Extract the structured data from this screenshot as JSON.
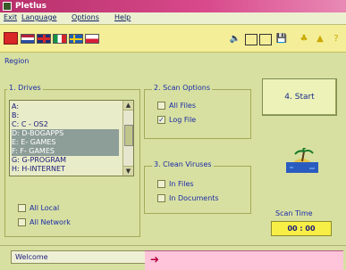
{
  "window": {
    "title": "Pletlus"
  },
  "menu": [
    "Exit",
    "Language",
    "Options",
    "Help"
  ],
  "toolbar": {
    "flags": [
      "flag-netherlands",
      "flag-uk",
      "flag-italy",
      "flag-sweden",
      "flag-poland"
    ],
    "tools": [
      "speaker",
      "window",
      "document",
      "save",
      "tree",
      "shape",
      "help"
    ]
  },
  "section": {
    "label": "Region"
  },
  "drives": {
    "title": "1. Drives",
    "rows": [
      {
        "text": "A:",
        "selected": false
      },
      {
        "text": "B:",
        "selected": false
      },
      {
        "text": "C:  C - OS2",
        "selected": false
      },
      {
        "text": "D:  D-BOGAPPS",
        "selected": true
      },
      {
        "text": "E:  E- GAMES",
        "selected": true
      },
      {
        "text": "F:  F- GAMES",
        "selected": true
      },
      {
        "text": "G:  G-PROGRAM",
        "selected": false
      },
      {
        "text": "H:  H-INTERNET",
        "selected": false
      }
    ],
    "all_local": "All Local",
    "all_network": "All Network"
  },
  "scan_options": {
    "title": "2. Scan Options",
    "all_files": "All Files",
    "log_file": "Log File"
  },
  "clean_viruses": {
    "title": "3. Clean Viruses",
    "in_files": "In Files",
    "in_documents": "In Documents"
  },
  "start": {
    "label": "4. Start"
  },
  "scan_time": {
    "label": "Scan Time",
    "value": "00 : 00"
  },
  "status": {
    "text": "Welcome"
  }
}
